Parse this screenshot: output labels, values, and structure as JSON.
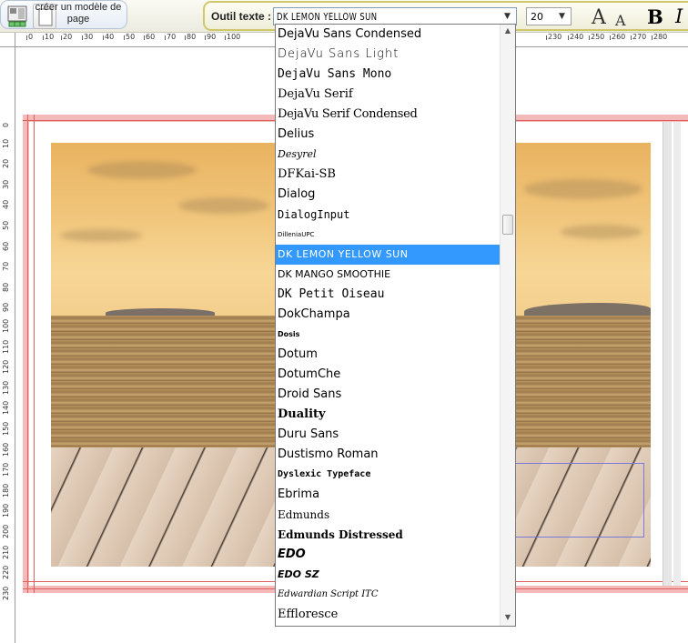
{
  "toolbar": {
    "model_button_label": "créer un modèle de page",
    "text_tool_label": "Outil texte :",
    "font_value": "DK LEMON YELLOW SUN",
    "size_value": "20",
    "grow_label": "A",
    "shrink_label": "A",
    "bold_label": "B",
    "italic_label": "I"
  },
  "ruler": {
    "horizontal": [
      "0",
      "10",
      "20",
      "30",
      "40",
      "50",
      "60",
      "70",
      "80",
      "90",
      "100",
      "230",
      "240",
      "250",
      "260",
      "270",
      "280"
    ],
    "vertical": [
      "0",
      "10",
      "20",
      "30",
      "40",
      "50",
      "60",
      "70",
      "80",
      "90",
      "100",
      "110",
      "120",
      "130",
      "140",
      "150",
      "160",
      "170",
      "180",
      "190",
      "200",
      "210",
      "220",
      "230"
    ]
  },
  "font_list": {
    "items": [
      "DejaVu Sans Condensed",
      "DejaVu Sans Light",
      "DejaVu Sans Mono",
      "DejaVu Serif",
      "DejaVu Serif Condensed",
      "Delius",
      "Desyrel",
      "DFKai-SB",
      "Dialog",
      "DialogInput",
      "DilleniaUPC",
      "DK LEMON YELLOW SUN",
      "DK MANGO SMOOTHIE",
      "DK Petit Oiseau",
      "DokChampa",
      "Dosis",
      "Dotum",
      "DotumChe",
      "Droid Sans",
      "Duality",
      "Duru Sans",
      "Dustismo Roman",
      "Dyslexic Typeface",
      "Ebrima",
      "Edmunds",
      "Edmunds Distressed",
      "EDO",
      "EDO SZ",
      "Edwardian Script ITC",
      "Effloresce"
    ],
    "selected": "DK LEMON YELLOW SUN"
  },
  "colors": {
    "accent": "#3399ff",
    "bleed": "#f4b9b9",
    "guide": "#e06060",
    "toolbar_border": "#cfc86a"
  }
}
